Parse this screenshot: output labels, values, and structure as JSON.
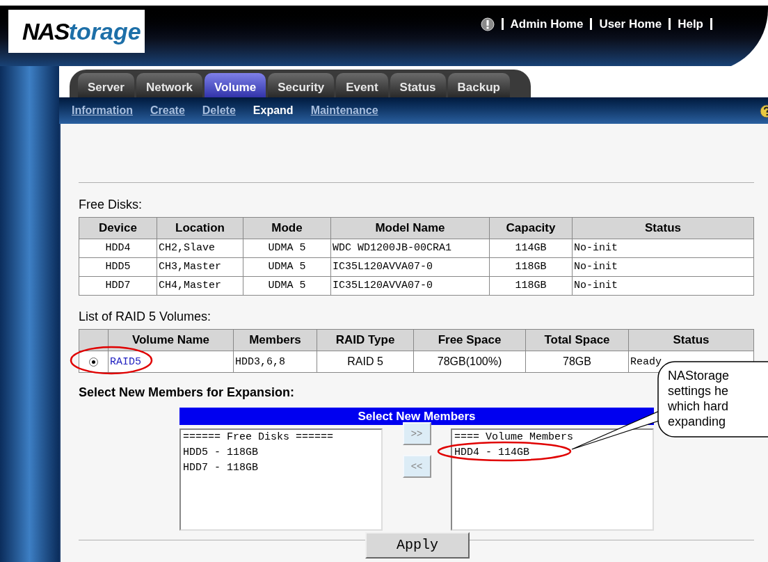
{
  "header": {
    "logo": {
      "bold": "NAS",
      "italic": "torage"
    },
    "links": [
      "Admin Home",
      "User Home",
      "Help"
    ]
  },
  "tabs": [
    {
      "label": "Server",
      "selected": false
    },
    {
      "label": "Network",
      "selected": false
    },
    {
      "label": "Volume",
      "selected": true
    },
    {
      "label": "Security",
      "selected": false
    },
    {
      "label": "Event",
      "selected": false
    },
    {
      "label": "Status",
      "selected": false
    },
    {
      "label": "Backup",
      "selected": false
    }
  ],
  "subnav": [
    {
      "label": "Information",
      "selected": false
    },
    {
      "label": "Create",
      "selected": false
    },
    {
      "label": "Delete",
      "selected": false
    },
    {
      "label": "Expand",
      "selected": true
    },
    {
      "label": "Maintenance",
      "selected": false
    }
  ],
  "free_disks": {
    "title": "Free Disks:",
    "columns": [
      "Device",
      "Location",
      "Mode",
      "Model Name",
      "Capacity",
      "Status"
    ],
    "rows": [
      [
        "HDD4",
        "CH2,Slave",
        "UDMA 5",
        "WDC WD1200JB-00CRA1",
        "114GB",
        "No-init"
      ],
      [
        "HDD5",
        "CH3,Master",
        "UDMA 5",
        "IC35L120AVVA07-0",
        "118GB",
        "No-init"
      ],
      [
        "HDD7",
        "CH4,Master",
        "UDMA 5",
        "IC35L120AVVA07-0",
        "118GB",
        "No-init"
      ]
    ]
  },
  "raid_volumes": {
    "title": "List of RAID 5 Volumes:",
    "columns": [
      "Volume Name",
      "Members",
      "RAID Type",
      "Free Space",
      "Total Space",
      "Status"
    ],
    "rows": [
      {
        "selected": true,
        "cells": [
          "RAID5",
          "HDD3,6,8",
          "RAID 5",
          "78GB(100%)",
          "78GB",
          "Ready"
        ]
      }
    ]
  },
  "expansion": {
    "title": "Select New Members for Expansion:",
    "panel_title": "Select New Members",
    "free_list": [
      "====== Free Disks ======",
      "HDD5 - 118GB",
      "HDD7 - 118GB"
    ],
    "member_list": [
      "==== Volume Members",
      "HDD4 - 114GB"
    ],
    "add_button": ">>",
    "remove_button": "<<",
    "apply_button": "Apply"
  },
  "callout": {
    "lines": [
      "NAStorage",
      "settings he",
      "which hard",
      "expanding"
    ]
  }
}
